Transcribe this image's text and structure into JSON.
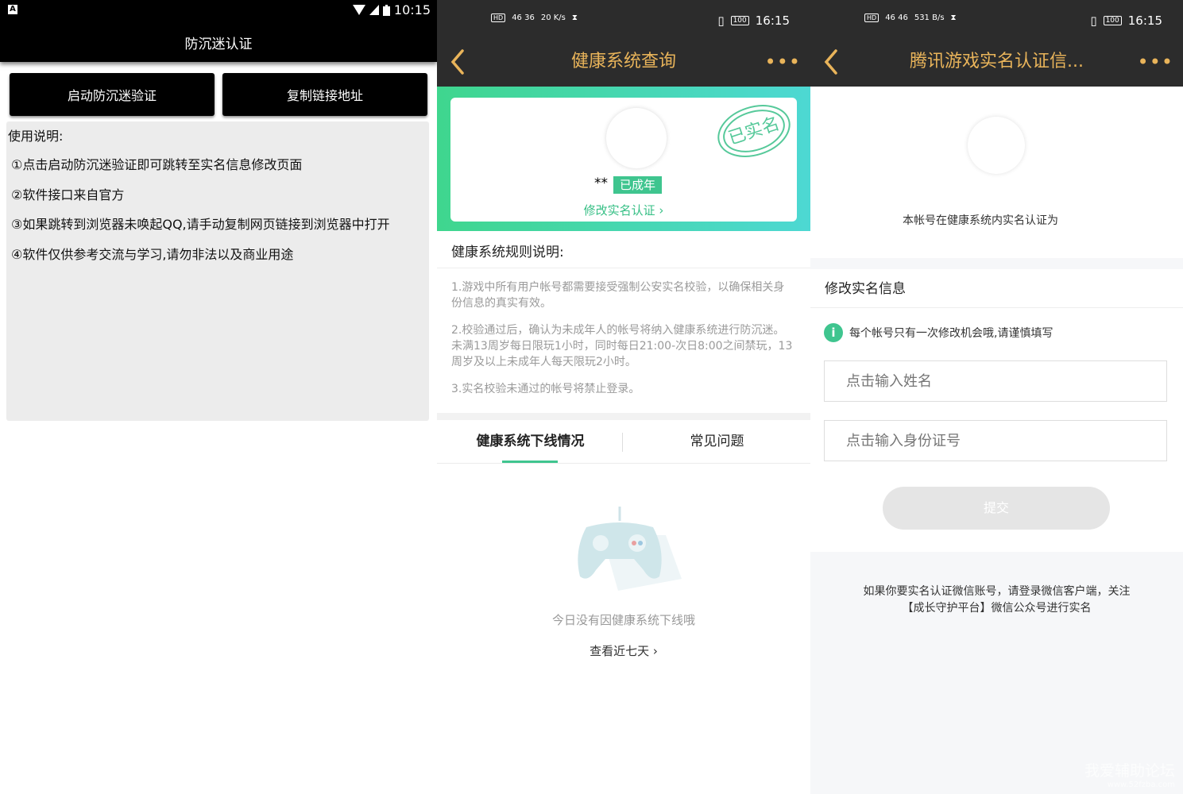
{
  "panel1": {
    "status_time": "10:15",
    "status_left_icon": "A",
    "title": "防沉迷认证",
    "buttons": {
      "start": "启动防沉迷验证",
      "copy": "复制链接地址"
    },
    "instructions_title": "使用说明:",
    "instructions": [
      "①点击启动防沉迷验证即可跳转至实名信息修改页面",
      "②软件接口来自官方",
      "③如果跳转到浏览器未唤起QQ,请手动复制网页链接到浏览器中打开",
      "④软件仅供参考交流与学习,请勿非法以及商业用途"
    ]
  },
  "panel2": {
    "status": {
      "network_left": "46 36",
      "speed": "20 K/s",
      "battery": "100",
      "time": "16:15"
    },
    "title": "健康系统查询",
    "more": "•••",
    "profile": {
      "name": "**",
      "badge": "已成年",
      "modify": "修改实名认证",
      "stamp": "已实名"
    },
    "rules_title": "健康系统规则说明:",
    "rules": [
      "1.游戏中所有用户帐号都需要接受强制公安实名校验，以确保相关身份信息的真实有效。",
      "2.校验通过后，确认为未成年人的帐号将纳入健康系统进行防沉迷。未满13周岁每日限玩1小时，同时每日21:00-次日8:00之间禁玩，13周岁及以上未成年人每天限玩2小时。",
      "3.实名校验未通过的帐号将禁止登录。"
    ],
    "tabs": [
      "健康系统下线情况",
      "常见问题"
    ],
    "empty_text": "今日没有因健康系统下线哦",
    "week_link": "查看近七天"
  },
  "panel3": {
    "status": {
      "speed": "531 B/s",
      "battery": "100",
      "time": "16:15"
    },
    "title": "腾讯游戏实名认证信...",
    "more": "•••",
    "cert_text": "本帐号在健康系统内实名认证为",
    "section_title": "修改实名信息",
    "note": "每个帐号只有一次修改机会哦,请谨慎填写",
    "name_placeholder": "点击输入姓名",
    "id_placeholder": "点击输入身份证号",
    "submit": "提交",
    "wechat_lines": [
      "如果你要实名认证微信账号，请登录微信客户端，关注",
      "【成长守护平台】微信公众号进行实名"
    ],
    "watermark": {
      "main": "我爱辅助论坛",
      "url": "www.52fzba.com"
    }
  },
  "colors": {
    "accent_green": "#3fc58f",
    "title_gold": "#e9b45a",
    "dark_bar": "#2c2c2c"
  }
}
